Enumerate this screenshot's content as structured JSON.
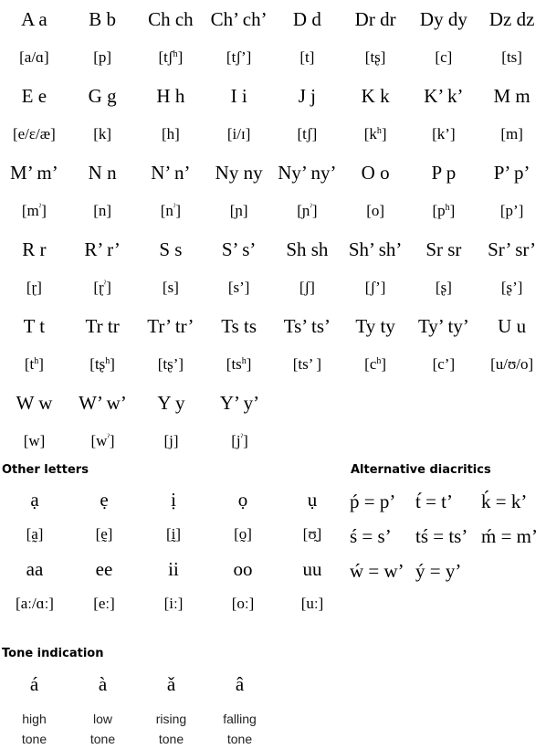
{
  "alphabet": {
    "rows": [
      {
        "letters": [
          "A a",
          "B b",
          "Ch ch",
          "Ch’ ch’",
          "D d",
          "Dr dr",
          "Dy dy",
          "Dz dz"
        ],
        "ipa": [
          [
            "a/ɑ",
            ""
          ],
          [
            "p",
            ""
          ],
          [
            "tʃ",
            "h"
          ],
          [
            "tʃ’",
            ""
          ],
          [
            "t",
            ""
          ],
          [
            "tʂ",
            ""
          ],
          [
            "c",
            ""
          ],
          [
            "ts",
            ""
          ]
        ]
      },
      {
        "letters": [
          "E e",
          "G g",
          "H h",
          "I i",
          "J j",
          "K k",
          "K’ k’",
          "M m"
        ],
        "ipa": [
          [
            "e/ɛ/æ",
            ""
          ],
          [
            "k",
            ""
          ],
          [
            "h",
            ""
          ],
          [
            "i/ɪ",
            ""
          ],
          [
            "tʃ",
            ""
          ],
          [
            "k",
            "h"
          ],
          [
            "k’",
            ""
          ],
          [
            "m",
            ""
          ]
        ]
      },
      {
        "letters": [
          "M’ m’",
          "N n",
          "N’ n’",
          "Ny ny",
          "Ny’ ny’",
          "O o",
          "P p",
          "P’ p’"
        ],
        "ipa": [
          [
            "m",
            "ˀ"
          ],
          [
            "n",
            ""
          ],
          [
            "n",
            "ˀ"
          ],
          [
            "ɲ",
            ""
          ],
          [
            "ɲ",
            "ˀ"
          ],
          [
            "o",
            ""
          ],
          [
            "p",
            "h"
          ],
          [
            "p’",
            ""
          ]
        ]
      },
      {
        "letters": [
          "R r",
          "R’ r’",
          "S s",
          "S’ s’",
          "Sh sh",
          "Sh’ sh’",
          "Sr sr",
          "Sr’ sr’"
        ],
        "ipa": [
          [
            "ɽ",
            ""
          ],
          [
            "ɽ",
            "ˀ"
          ],
          [
            "s",
            ""
          ],
          [
            "s’",
            ""
          ],
          [
            "ʃ",
            ""
          ],
          [
            "ʃ’",
            ""
          ],
          [
            "ʂ",
            ""
          ],
          [
            "ʂ’",
            ""
          ]
        ]
      },
      {
        "letters": [
          "T t",
          "Tr tr",
          "Tr’ tr’",
          "Ts ts",
          "Ts’ ts’",
          "Ty ty",
          "Ty’ ty’",
          "U u"
        ],
        "ipa": [
          [
            "t",
            "h"
          ],
          [
            "tʂ",
            "h"
          ],
          [
            "tʂ’",
            ""
          ],
          [
            "ts",
            "h"
          ],
          [
            "ts’ ",
            ""
          ],
          [
            "c",
            "h"
          ],
          [
            "c’",
            ""
          ],
          [
            "u/ʊ/o",
            ""
          ]
        ]
      },
      {
        "letters": [
          "W w",
          "W’ w’",
          "Y y",
          "Y’ y’"
        ],
        "ipa": [
          [
            "w",
            ""
          ],
          [
            "w",
            "ˀ"
          ],
          [
            "j",
            ""
          ],
          [
            "j",
            "ˀ"
          ]
        ]
      }
    ]
  },
  "other_letters": {
    "heading": "Other letters",
    "rows": [
      {
        "letters": [
          "ạ",
          "ẹ",
          "ị",
          "ọ",
          "ụ"
        ],
        "ipa": [
          "a̰",
          "ḛ",
          "ḭ",
          "o̰",
          "ʊ̰"
        ]
      },
      {
        "letters": [
          "aa",
          "ee",
          "ii",
          "oo",
          "uu"
        ],
        "ipa": [
          "aː/ɑː",
          "eː",
          "iː",
          "oː",
          "uː"
        ]
      }
    ]
  },
  "alternative_diacritics": {
    "heading": "Alternative diacritics",
    "rows": [
      [
        "ṕ = p’",
        "t́ = t’",
        "ḱ = k’"
      ],
      [
        "ś = s’",
        "tś = ts’",
        "ḿ = m’"
      ],
      [
        "ẃ = w’",
        "ý = y’"
      ]
    ]
  },
  "tone_indication": {
    "heading": "Tone indication",
    "marks": [
      "á",
      "à",
      "ǎ",
      "â"
    ],
    "labels": [
      [
        "high",
        "tone"
      ],
      [
        "low",
        "tone"
      ],
      [
        "rising",
        "tone"
      ],
      [
        "falling",
        "tone"
      ]
    ]
  }
}
